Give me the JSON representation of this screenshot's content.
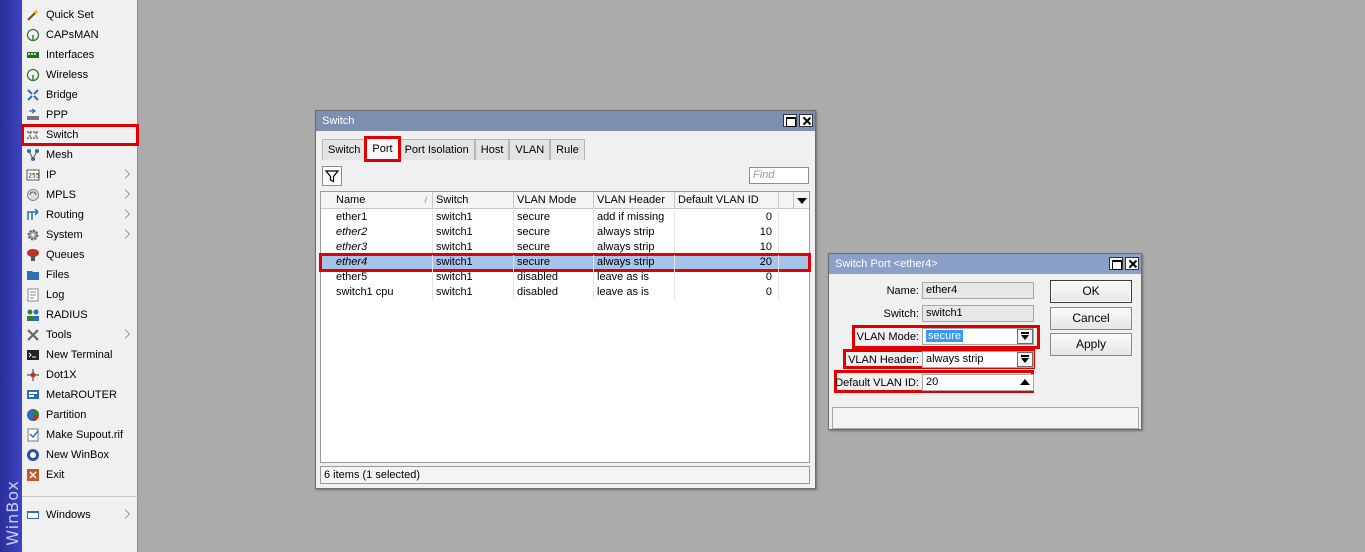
{
  "brand": "WinBox",
  "sidebar": {
    "items": [
      {
        "label": "Quick Set",
        "icon": "wand-icon",
        "arrow": false
      },
      {
        "label": "CAPsMAN",
        "icon": "antenna-icon",
        "arrow": false
      },
      {
        "label": "Interfaces",
        "icon": "interfaces-icon",
        "arrow": false
      },
      {
        "label": "Wireless",
        "icon": "wireless-icon",
        "arrow": false
      },
      {
        "label": "Bridge",
        "icon": "bridge-icon",
        "arrow": false
      },
      {
        "label": "PPP",
        "icon": "ppp-icon",
        "arrow": false
      },
      {
        "label": "Switch",
        "icon": "switch-icon",
        "arrow": false
      },
      {
        "label": "Mesh",
        "icon": "mesh-icon",
        "arrow": false
      },
      {
        "label": "IP",
        "icon": "ip-icon",
        "arrow": true
      },
      {
        "label": "MPLS",
        "icon": "mpls-icon",
        "arrow": true
      },
      {
        "label": "Routing",
        "icon": "routing-icon",
        "arrow": true
      },
      {
        "label": "System",
        "icon": "gear-icon",
        "arrow": true
      },
      {
        "label": "Queues",
        "icon": "queues-icon",
        "arrow": false
      },
      {
        "label": "Files",
        "icon": "folder-icon",
        "arrow": false
      },
      {
        "label": "Log",
        "icon": "log-icon",
        "arrow": false
      },
      {
        "label": "RADIUS",
        "icon": "radius-icon",
        "arrow": false
      },
      {
        "label": "Tools",
        "icon": "tools-icon",
        "arrow": true
      },
      {
        "label": "New Terminal",
        "icon": "terminal-icon",
        "arrow": false
      },
      {
        "label": "Dot1X",
        "icon": "dot1x-icon",
        "arrow": false
      },
      {
        "label": "MetaROUTER",
        "icon": "metarouter-icon",
        "arrow": false
      },
      {
        "label": "Partition",
        "icon": "partition-icon",
        "arrow": false
      },
      {
        "label": "Make Supout.rif",
        "icon": "supout-icon",
        "arrow": false
      },
      {
        "label": "New WinBox",
        "icon": "winbox-icon",
        "arrow": false
      },
      {
        "label": "Exit",
        "icon": "exit-icon",
        "arrow": false
      },
      {
        "label": "Windows",
        "icon": "windows-icon",
        "arrow": true
      }
    ]
  },
  "switch_window": {
    "title": "Switch",
    "tabs": [
      "Switch",
      "Port",
      "Port Isolation",
      "Host",
      "VLAN",
      "Rule"
    ],
    "active_tab": "Port",
    "find_placeholder": "Find",
    "columns": [
      "Name",
      "Switch",
      "VLAN Mode",
      "VLAN Header",
      "Default VLAN ID"
    ],
    "rows": [
      {
        "name": "ether1",
        "switch": "switch1",
        "vlan_mode": "secure",
        "vlan_header": "add if missing",
        "default_vlan_id": "0",
        "italic": false
      },
      {
        "name": "ether2",
        "switch": "switch1",
        "vlan_mode": "secure",
        "vlan_header": "always strip",
        "default_vlan_id": "10",
        "italic": true
      },
      {
        "name": "ether3",
        "switch": "switch1",
        "vlan_mode": "secure",
        "vlan_header": "always strip",
        "default_vlan_id": "10",
        "italic": true
      },
      {
        "name": "ether4",
        "switch": "switch1",
        "vlan_mode": "secure",
        "vlan_header": "always strip",
        "default_vlan_id": "20",
        "italic": true
      },
      {
        "name": "ether5",
        "switch": "switch1",
        "vlan_mode": "disabled",
        "vlan_header": "leave as is",
        "default_vlan_id": "0",
        "italic": false
      },
      {
        "name": "switch1 cpu",
        "switch": "switch1",
        "vlan_mode": "disabled",
        "vlan_header": "leave as is",
        "default_vlan_id": "0",
        "italic": false
      }
    ],
    "selected_row": 3,
    "status": "6 items (1 selected)"
  },
  "port_dialog": {
    "title": "Switch Port <ether4>",
    "fields": {
      "name_label": "Name:",
      "name_value": "ether4",
      "switch_label": "Switch:",
      "switch_value": "switch1",
      "vlan_mode_label": "VLAN Mode:",
      "vlan_mode_value": "secure",
      "vlan_header_label": "VLAN Header:",
      "vlan_header_value": "always strip",
      "default_vlan_label": "Default VLAN ID:",
      "default_vlan_value": "20"
    },
    "buttons": {
      "ok": "OK",
      "cancel": "Cancel",
      "apply": "Apply"
    }
  },
  "colors": {
    "highlight": "#e00000",
    "selection": "#a6c4ea",
    "brand_bar": "#3d44c0"
  }
}
